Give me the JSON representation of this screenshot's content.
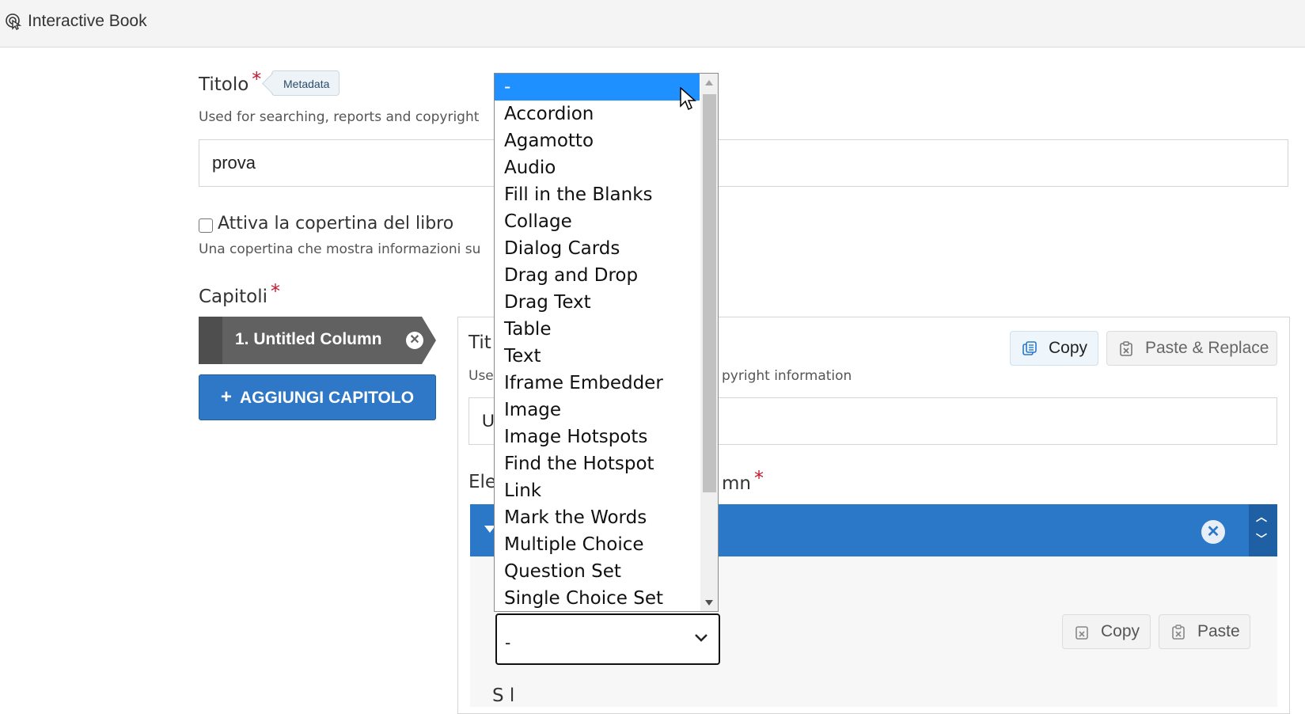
{
  "app": {
    "title": "Interactive Book"
  },
  "colors": {
    "accent": "#2a78c7",
    "required": "#c6172d",
    "selected_option": "#1e90ff"
  },
  "form": {
    "title_label": "Titolo",
    "required_mark": "*",
    "metadata_label": "Metadata",
    "title_desc": "Used for searching, reports and copyright",
    "title_value": "prova",
    "cover_label": "Attiva la copertina del libro",
    "cover_checked": false,
    "cover_desc": "Una copertina che mostra informazioni su"
  },
  "chapters": {
    "label": "Capitoli",
    "items": [
      {
        "label": "1. Untitled Column"
      }
    ],
    "add_label": "AGGIUNGI CAPITOLO"
  },
  "panel": {
    "title_label_partial": "Tit",
    "desc_left_partial": "Use",
    "desc_right_partial": "pyright information",
    "input_value_partial": "U",
    "elements_label_left": "Ele",
    "elements_label_right": "mn",
    "copy_label": "Copy",
    "paste_replace_label": "Paste & Replace",
    "paste_label": "Paste",
    "bottom_partial": "S                                        l"
  },
  "library_select": {
    "value": "-",
    "options": [
      "-",
      "Accordion",
      "Agamotto",
      "Audio",
      "Fill in the Blanks",
      "Collage",
      "Dialog Cards",
      "Drag and Drop",
      "Drag Text",
      "Table",
      "Text",
      "Iframe Embedder",
      "Image",
      "Image Hotspots",
      "Find the Hotspot",
      "Link",
      "Mark the Words",
      "Multiple Choice",
      "Question Set",
      "Single Choice Set"
    ],
    "selected_index": 0
  },
  "icons": {
    "logo": "pointer-hand-icon",
    "copy": "copy-icon",
    "paste": "clipboard-x-icon",
    "remove": "close-circle-icon",
    "chevron": "chevron-down-icon",
    "move": "up-down-arrows-icon"
  }
}
